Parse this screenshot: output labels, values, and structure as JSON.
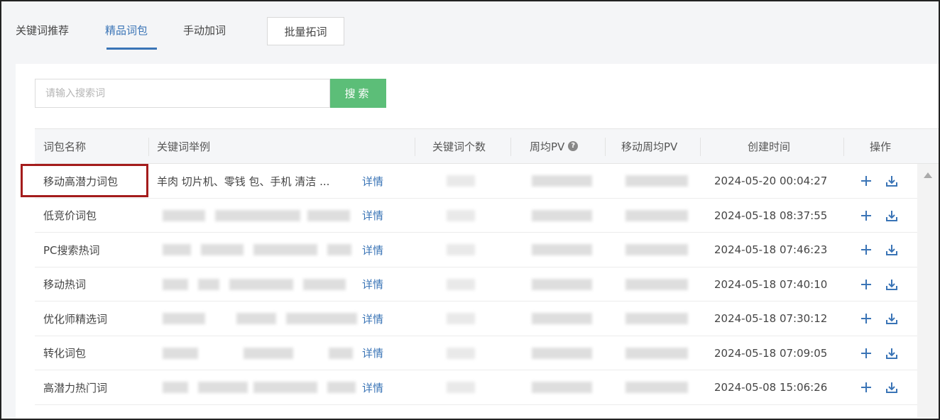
{
  "tabs": {
    "items": [
      {
        "label": "关键词推荐"
      },
      {
        "label": "精品词包"
      },
      {
        "label": "手动加词"
      }
    ],
    "button_label": "批量拓词",
    "active_index": 1
  },
  "search": {
    "placeholder": "请输入搜索词",
    "value": "",
    "button_label": "搜索"
  },
  "table": {
    "columns": [
      "词包名称",
      "关键词举例",
      "关键词个数",
      "周均PV",
      "移动周均PV",
      "创建时间",
      "操作"
    ],
    "rows": [
      {
        "name": "移动高潜力词包",
        "example": "羊肉 切片机、零钱 包、手机 清洁 ...",
        "detail": "详情",
        "created": "2024-05-20 00:04:27"
      },
      {
        "name": "低竞价词包",
        "example": "",
        "detail": "详情",
        "created": "2024-05-18 08:37:55"
      },
      {
        "name": "PC搜索热词",
        "example": "",
        "detail": "详情",
        "created": "2024-05-18 07:46:23"
      },
      {
        "name": "移动热词",
        "example": "",
        "detail": "详情",
        "created": "2024-05-18 07:40:10"
      },
      {
        "name": "优化师精选词",
        "example": "",
        "detail": "详情",
        "created": "2024-05-18 07:30:12"
      },
      {
        "name": "转化词包",
        "example": "",
        "detail": "详情",
        "created": "2024-05-18 07:09:05"
      },
      {
        "name": "高潜力热门词",
        "example": "",
        "detail": "详情",
        "created": "2024-05-08 15:06:26"
      }
    ]
  },
  "icons": {
    "add": "plus-icon",
    "download": "download-icon",
    "help": "question-circle-icon",
    "scroll_up": "scroll-up-arrow-icon"
  },
  "colors": {
    "accent": "#3a74b6",
    "search_button": "#5cbe78",
    "highlight_box": "#a41c1c"
  }
}
